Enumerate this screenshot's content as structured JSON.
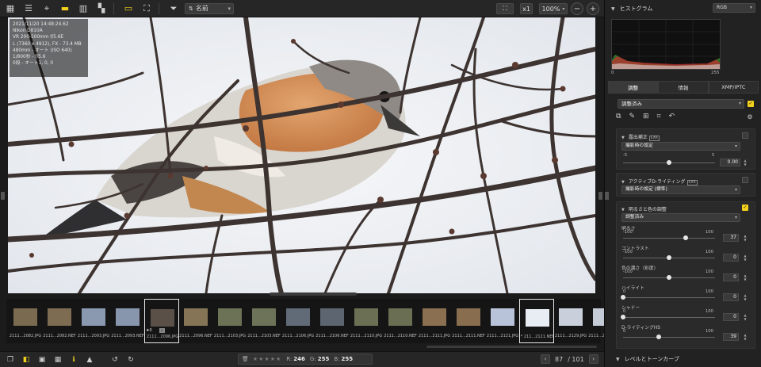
{
  "toolbar": {
    "icons": [
      "grid-view-icon",
      "list-view-icon",
      "map-pin-icon",
      "single-view-icon",
      "filmstrip-icon",
      "compare-icon",
      "highlight-icon",
      "fullscreen-icon",
      "filter-icon",
      "sort-icon"
    ],
    "sort_label": "名前",
    "zoom_fit": "⛶",
    "zoom_1x": "x1",
    "zoom_level": "100%"
  },
  "photo_info": {
    "lines": [
      "2021/11/20 14:48:24.62",
      "Nikon D810A",
      "VR 200-500mm f/5.6E",
      "L (7360 x 4912), FX - 73.4 MB",
      "480mm - オート (ISO 640)",
      "1/800秒 - f/5.6",
      "0段 - オート1, 0, 0"
    ]
  },
  "thumbnails": [
    {
      "label": "2111...2082.JPG",
      "tone": "#7a6a50"
    },
    {
      "label": "2111...2082.NEF",
      "tone": "#7d6c52"
    },
    {
      "label": "2111...2093.JPG",
      "tone": "#8a98b0"
    },
    {
      "label": "2111...2093.NEF",
      "tone": "#8896ad"
    },
    {
      "label": "2111...2096.JPG",
      "tone": "#5b5048",
      "selected": true,
      "rating": "★0"
    },
    {
      "label": "2111...2096.NEF",
      "tone": "#857556"
    },
    {
      "label": "2111...2103.JPG",
      "tone": "#6b7256"
    },
    {
      "label": "2111...2103.NEF",
      "tone": "#6d7358"
    },
    {
      "label": "2111...2106.JPG",
      "tone": "#616b77"
    },
    {
      "label": "2111...2106.NEF",
      "tone": "#5d6571"
    },
    {
      "label": "2111...2110.JPG",
      "tone": "#6b7054"
    },
    {
      "label": "2111...2110.NEF",
      "tone": "#6a6e53"
    },
    {
      "label": "2111...2111.JPG",
      "tone": "#8a7050"
    },
    {
      "label": "2111...2111.NEF",
      "tone": "#886e4f"
    },
    {
      "label": "2111...2121.JPG",
      "tone": "#b8c2d8"
    },
    {
      "label": "* 211...2121.NEF",
      "tone": "#e8edf4",
      "selected": true
    },
    {
      "label": "2111...2129.JPG",
      "tone": "#c9d0db"
    },
    {
      "label": "2111...2129.NEF",
      "tone": "#c6ccd7"
    }
  ],
  "bottombar": {
    "stars": "★★★★★",
    "r_label": "R:",
    "r_value": "246",
    "g_label": "G:",
    "g_value": "255",
    "b_label": "B:",
    "b_value": "255",
    "page_current": "87",
    "page_total": "/ 101"
  },
  "panel": {
    "histogram_title": "ヒストグラム",
    "histogram_channel": "RGB",
    "hist_min": "0",
    "hist_max": "255",
    "tabs": [
      "調整",
      "情報",
      "XMP/IPTC"
    ],
    "preset": "調整済み",
    "sections": {
      "exposure": {
        "title": "露出補正",
        "tag": "EXR",
        "mode": "撮影時の設定",
        "min": "-5",
        "max": "5",
        "value": "0.00",
        "level": 0.5
      },
      "adl": {
        "title": "アクティブD-ライティング",
        "tag": "EXR",
        "mode": "撮影時の設定 (標準)"
      },
      "brightness": {
        "title": "明るさと色の調整",
        "mode": "調整済み",
        "params": [
          {
            "label": "明るさ",
            "min": "-100",
            "max": "100",
            "value": "37",
            "level": 0.685
          },
          {
            "label": "コントラスト",
            "min": "-100",
            "max": "100",
            "value": "0",
            "level": 0.5
          },
          {
            "label": "色の濃さ（彩度）",
            "min": "-100",
            "max": "100",
            "value": "0",
            "level": 0.5
          },
          {
            "label": "ハイライト",
            "min": "0",
            "max": "100",
            "value": "0",
            "level": 0
          },
          {
            "label": "シャドー",
            "min": "0",
            "max": "100",
            "value": "0",
            "level": 0
          },
          {
            "label": "D-ライティングHS",
            "min": "0",
            "max": "100",
            "value": "39",
            "level": 0.39
          }
        ]
      },
      "levels": {
        "title": "レベルとトーンカーブ"
      }
    }
  }
}
